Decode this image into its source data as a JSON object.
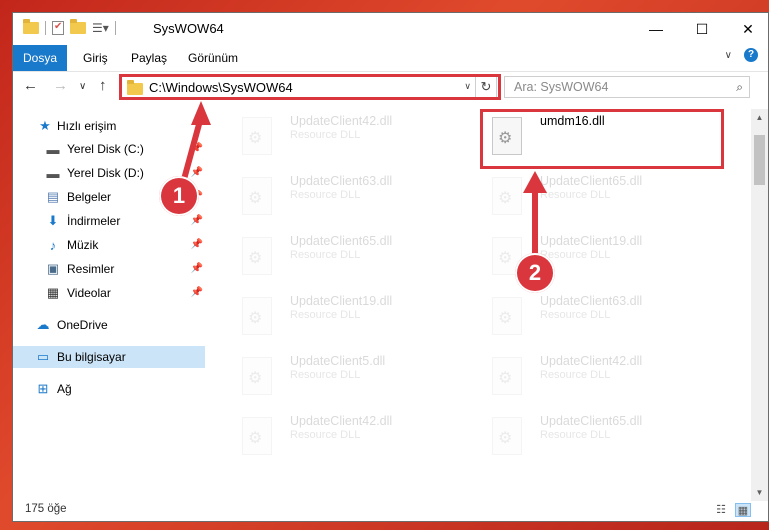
{
  "window": {
    "title": "SysWOW64",
    "minimize_glyph": "—",
    "maximize_glyph": "☐",
    "close_glyph": "✕"
  },
  "ribbon": {
    "tabs": [
      {
        "label": "Dosya",
        "active": true
      },
      {
        "label": "Giriş",
        "active": false
      },
      {
        "label": "Paylaş",
        "active": false
      },
      {
        "label": "Görünüm",
        "active": false
      }
    ],
    "expand_glyph": "∨",
    "help_glyph": "?"
  },
  "nav": {
    "back_glyph": "←",
    "forward_glyph": "→",
    "recent_glyph": "∨",
    "up_glyph": "↑",
    "address": "C:\\Windows\\SysWOW64",
    "address_chevron": "∨",
    "refresh_glyph": "↻",
    "search_placeholder": "Ara: SysWOW64",
    "search_icon": "search-icon"
  },
  "sidebar": {
    "items": [
      {
        "label": "Hızlı erişim",
        "icon": "star-icon",
        "pinned": false,
        "selected": false
      },
      {
        "label": "Yerel Disk (C:)",
        "icon": "drive-icon",
        "pinned": true,
        "selected": false
      },
      {
        "label": "Yerel Disk (D:)",
        "icon": "drive-icon",
        "pinned": true,
        "selected": false
      },
      {
        "label": "Belgeler",
        "icon": "documents-icon",
        "pinned": true,
        "selected": false
      },
      {
        "label": "İndirmeler",
        "icon": "download-icon",
        "pinned": true,
        "selected": false
      },
      {
        "label": "Müzik",
        "icon": "music-icon",
        "pinned": true,
        "selected": false
      },
      {
        "label": "Resimler",
        "icon": "pictures-icon",
        "pinned": true,
        "selected": false
      },
      {
        "label": "Videolar",
        "icon": "video-icon",
        "pinned": true,
        "selected": false
      },
      {
        "label": "OneDrive",
        "icon": "cloud-icon",
        "pinned": false,
        "selected": false
      },
      {
        "label": "Bu bilgisayar",
        "icon": "computer-icon",
        "pinned": false,
        "selected": true
      },
      {
        "label": "Ağ",
        "icon": "network-icon",
        "pinned": false,
        "selected": false
      }
    ]
  },
  "files": [
    {
      "name": "UpdateClient42.dll",
      "type": "Resource DLL",
      "highlighted": false
    },
    {
      "name": "umdm16.dll",
      "type": "",
      "highlighted": true
    },
    {
      "name": "UpdateClient63.dll",
      "type": "Resource DLL",
      "highlighted": false
    },
    {
      "name": "UpdateClient65.dll",
      "type": "Resource DLL",
      "highlighted": false
    },
    {
      "name": "UpdateClient65.dll",
      "type": "Resource DLL",
      "highlighted": false
    },
    {
      "name": "UpdateClient19.dll",
      "type": "Resource DLL",
      "highlighted": false
    },
    {
      "name": "UpdateClient19.dll",
      "type": "Resource DLL",
      "highlighted": false
    },
    {
      "name": "UpdateClient63.dll",
      "type": "Resource DLL",
      "highlighted": false
    },
    {
      "name": "UpdateClient5.dll",
      "type": "Resource DLL",
      "highlighted": false
    },
    {
      "name": "UpdateClient42.dll",
      "type": "Resource DLL",
      "highlighted": false
    },
    {
      "name": "UpdateClient42.dll",
      "type": "Resource DLL",
      "highlighted": false
    },
    {
      "name": "UpdateClient65.dll",
      "type": "Resource DLL",
      "highlighted": false
    }
  ],
  "annotations": {
    "step1": "1",
    "step2": "2",
    "color": "#d9363e"
  },
  "status": {
    "count_text": "175 öğe"
  },
  "colors": {
    "accent": "#1979ca",
    "selection": "#cce4f7",
    "background": "#c2261b"
  }
}
